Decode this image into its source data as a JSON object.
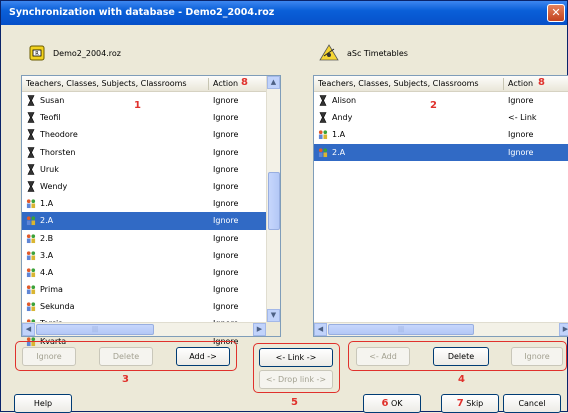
{
  "window": {
    "title": "Synchronization with database - Demo2_2004.roz",
    "close_glyph": "✕"
  },
  "left_app": {
    "name": "Demo2_2004.roz",
    "icon": "roz-database-icon"
  },
  "right_app": {
    "name": "aSc Timetables",
    "icon": "asc-timetables-icon"
  },
  "columns": {
    "name": "Teachers, Classes, Subjects, Classrooms",
    "action": "Action"
  },
  "left_list": {
    "annotation": "1",
    "action_annotation": "8",
    "rows": [
      {
        "name": "Susan",
        "action": "Ignore",
        "type": "teacher"
      },
      {
        "name": "Teofil",
        "action": "Ignore",
        "type": "teacher"
      },
      {
        "name": "Theodore",
        "action": "Ignore",
        "type": "teacher"
      },
      {
        "name": "Thorsten",
        "action": "Ignore",
        "type": "teacher"
      },
      {
        "name": "Uruk",
        "action": "Ignore",
        "type": "teacher"
      },
      {
        "name": "Wendy",
        "action": "Ignore",
        "type": "teacher"
      },
      {
        "name": "1.A",
        "action": "Ignore",
        "type": "class"
      },
      {
        "name": "2.A",
        "action": "Ignore",
        "type": "class",
        "selected": true
      },
      {
        "name": "2.B",
        "action": "Ignore",
        "type": "class"
      },
      {
        "name": "3.A",
        "action": "Ignore",
        "type": "class"
      },
      {
        "name": "4.A",
        "action": "Ignore",
        "type": "class"
      },
      {
        "name": "Prima",
        "action": "Ignore",
        "type": "class"
      },
      {
        "name": "Sekunda",
        "action": "Ignore",
        "type": "class"
      },
      {
        "name": "Tercia",
        "action": "Ignore",
        "type": "class"
      },
      {
        "name": "Kvarta",
        "action": "Ignore",
        "type": "class"
      }
    ]
  },
  "right_list": {
    "annotation": "2",
    "action_annotation": "8",
    "rows": [
      {
        "name": "Alison",
        "action": "Ignore",
        "type": "teacher"
      },
      {
        "name": "Andy",
        "action": "<- Link",
        "type": "teacher"
      },
      {
        "name": "1.A",
        "action": "Ignore",
        "type": "class"
      },
      {
        "name": "2.A",
        "action": "Ignore",
        "type": "class",
        "selected": true
      }
    ]
  },
  "left_buttons": {
    "ignore": "Ignore",
    "delete": "Delete",
    "add": "Add ->",
    "annotation": "3"
  },
  "middle_buttons": {
    "link": "<- Link ->",
    "drop_link": "<- Drop link ->",
    "annotation": "5"
  },
  "right_buttons": {
    "add": "<- Add",
    "delete": "Delete",
    "ignore": "Ignore",
    "annotation": "4"
  },
  "footer": {
    "help": "Help",
    "ok": "OK",
    "ok_annotation": "6",
    "skip": "Skip",
    "skip_annotation": "7",
    "cancel": "Cancel"
  },
  "colors": {
    "selection": "#316ac5",
    "annotation": "#e0312c",
    "titlebar": "#0a5fd8"
  }
}
